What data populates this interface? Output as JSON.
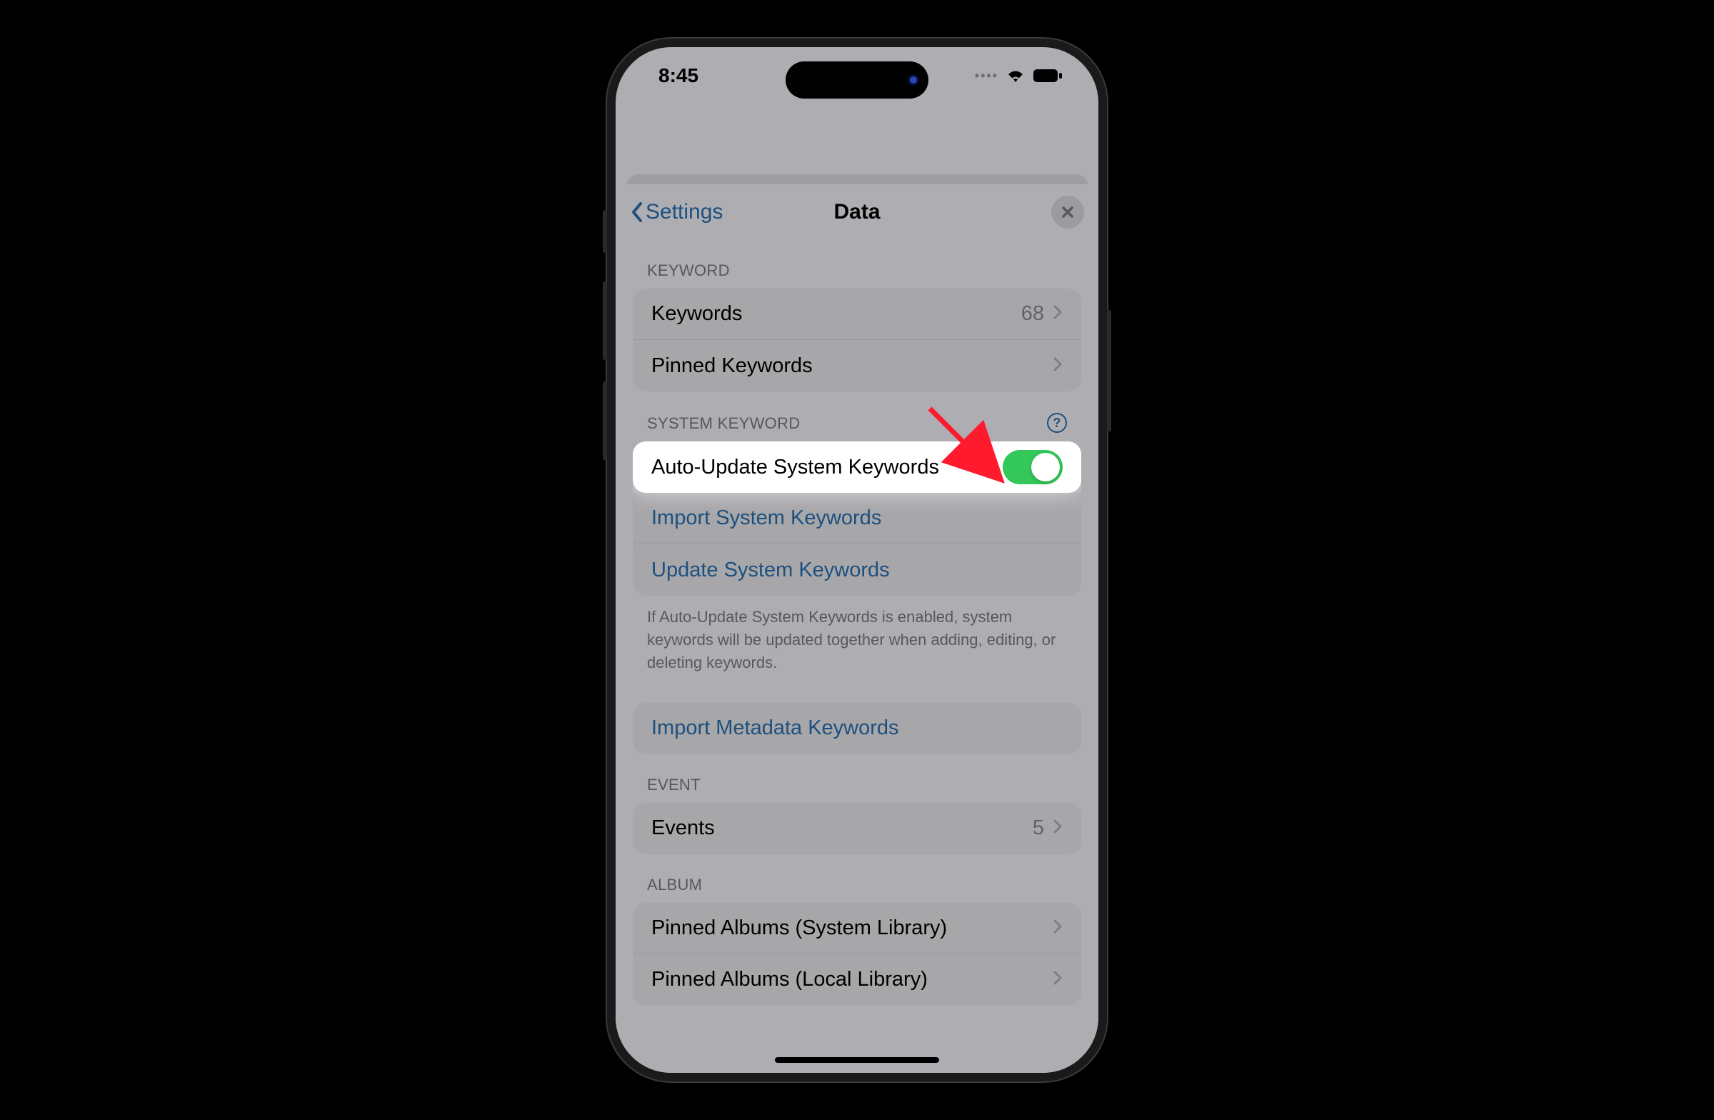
{
  "status": {
    "time": "8:45"
  },
  "nav": {
    "back": "Settings",
    "title": "Data"
  },
  "sections": {
    "keyword": {
      "header": "KEYWORD",
      "rows": {
        "keywords": {
          "label": "Keywords",
          "value": "68"
        },
        "pinned": {
          "label": "Pinned Keywords"
        }
      }
    },
    "system_keyword": {
      "header": "SYSTEM KEYWORD",
      "rows": {
        "auto_update": {
          "label": "Auto-Update System Keywords"
        },
        "import": {
          "label": "Import System Keywords"
        },
        "update": {
          "label": "Update System Keywords"
        }
      },
      "footer": "If Auto-Update System Keywords is enabled, system keywords will be updated together when adding, editing, or deleting keywords."
    },
    "metadata": {
      "rows": {
        "import": {
          "label": "Import Metadata Keywords"
        }
      }
    },
    "event": {
      "header": "EVENT",
      "rows": {
        "events": {
          "label": "Events",
          "value": "5"
        }
      }
    },
    "album": {
      "header": "ALBUM",
      "rows": {
        "system": {
          "label": "Pinned Albums (System Library)"
        },
        "local": {
          "label": "Pinned Albums (Local Library)"
        }
      }
    }
  }
}
